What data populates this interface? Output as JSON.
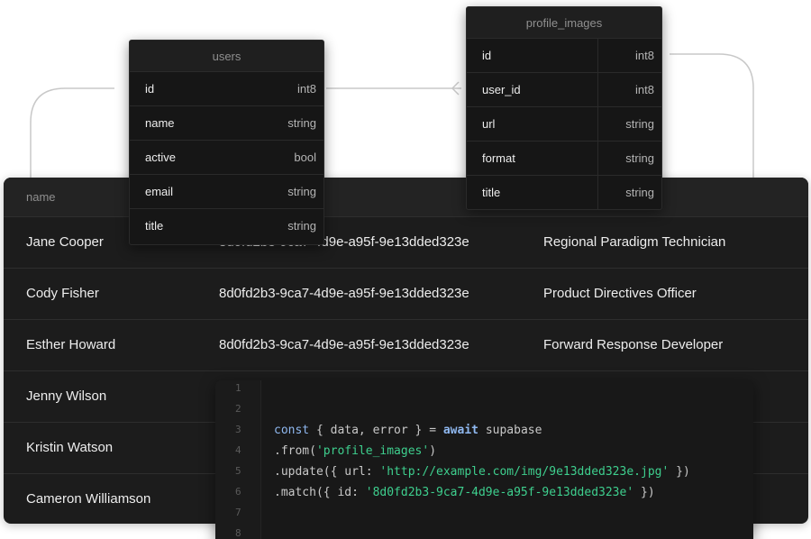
{
  "data_table": {
    "header": "name",
    "rows": [
      {
        "name": "Jane Cooper",
        "uuid": "8d0fd2b3-9ca7-4d9e-a95f-9e13dded323e",
        "title": "Regional Paradigm Technician"
      },
      {
        "name": "Cody Fisher",
        "uuid": "8d0fd2b3-9ca7-4d9e-a95f-9e13dded323e",
        "title": "Product Directives Officer"
      },
      {
        "name": "Esther Howard",
        "uuid": "8d0fd2b3-9ca7-4d9e-a95f-9e13dded323e",
        "title": "Forward Response Developer"
      },
      {
        "name": "Jenny Wilson",
        "uuid": "",
        "title": ""
      },
      {
        "name": "Kristin Watson",
        "uuid": "",
        "title": ""
      },
      {
        "name": "Cameron Williamson",
        "uuid": "",
        "title": ""
      }
    ]
  },
  "users_table": {
    "title": "users",
    "columns": [
      {
        "name": "id",
        "type": "int8"
      },
      {
        "name": "name",
        "type": "string"
      },
      {
        "name": "active",
        "type": "bool"
      },
      {
        "name": "email",
        "type": "string"
      },
      {
        "name": "title",
        "type": "string"
      }
    ]
  },
  "profile_images_table": {
    "title": "profile_images",
    "columns": [
      {
        "name": "id",
        "type": "int8"
      },
      {
        "name": "user_id",
        "type": "int8"
      },
      {
        "name": "url",
        "type": "string"
      },
      {
        "name": "format",
        "type": "string"
      },
      {
        "name": "title",
        "type": "string"
      }
    ]
  },
  "code": {
    "line_numbers": [
      "1",
      "2",
      "3",
      "4",
      "5",
      "6",
      "7",
      "8"
    ],
    "tokens": {
      "const": "const",
      "destructure": " { data, error } = ",
      "await": "await",
      "client": " supabase",
      "from_open": ".from(",
      "from_arg": "'profile_images'",
      "from_close": ")",
      "update_open": ".update({ url: ",
      "update_arg": "'http://example.com/img/9e13dded323e.jpg'",
      "update_close": " })",
      "match_open": ".match({ id: ",
      "match_arg": "'8d0fd2b3-9ca7-4d9e-a95f-9e13dded323e'",
      "match_close": " })"
    }
  },
  "colors": {
    "panel": "#1c1c1c",
    "string_literal": "#3ecf8e",
    "keyword": "#8fb8f0"
  }
}
